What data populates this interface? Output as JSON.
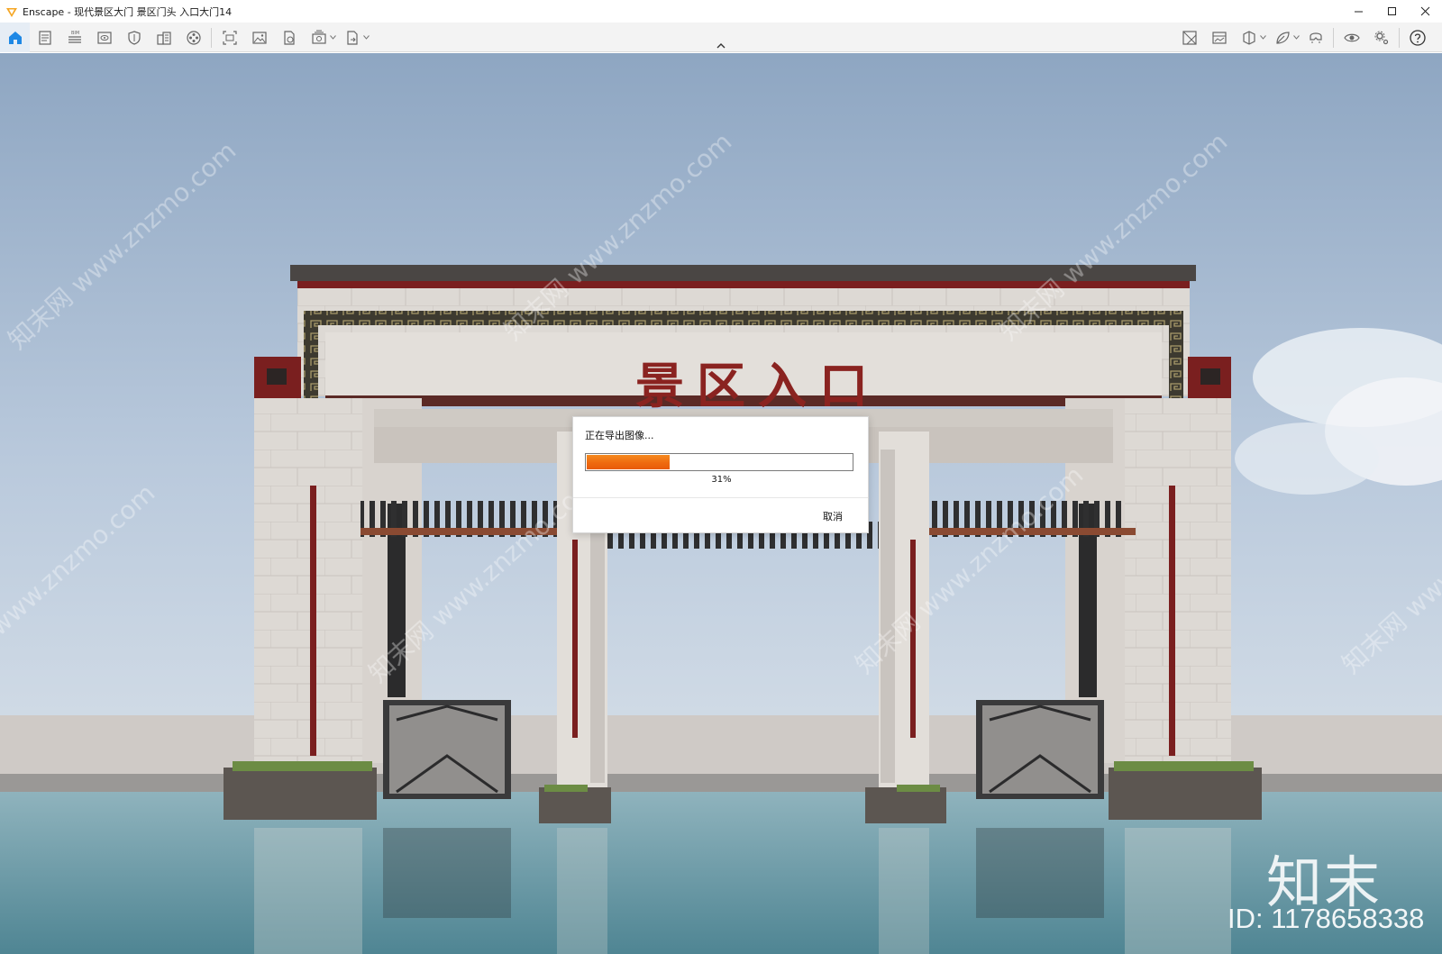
{
  "window": {
    "title": "Enscape - 现代景区大门 景区门头 入口大门14"
  },
  "toolbar": {
    "left_icons": [
      "home-icon",
      "document-icon",
      "bim-list-icon",
      "view-icon",
      "shield-icon",
      "buildings-icon",
      "film-reel-icon",
      "capture-frame-icon",
      "image-icon",
      "refresh-doc-icon",
      "batch-render-icon",
      "export-doc-icon"
    ],
    "right_icons": [
      "material-icon",
      "image-panel-icon",
      "cube-icon",
      "leaf-icon",
      "vr-headset-icon",
      "eye-icon",
      "settings-icon",
      "help-icon"
    ]
  },
  "viewport": {
    "gate_sign": "景区入口",
    "watermark_brand": "知末",
    "watermark_id": "ID: 1178658338",
    "watermark_site": "知末网 www.znzmo.com"
  },
  "export_dialog": {
    "title": "正在导出图像...",
    "progress_percent": 31,
    "progress_label": "31%",
    "cancel_label": "取消"
  },
  "colors": {
    "accent_blue": "#1e88e5",
    "progress_orange": "#ef6a10",
    "sky_top": "#8ea6c2",
    "water": "#6a98a4"
  }
}
